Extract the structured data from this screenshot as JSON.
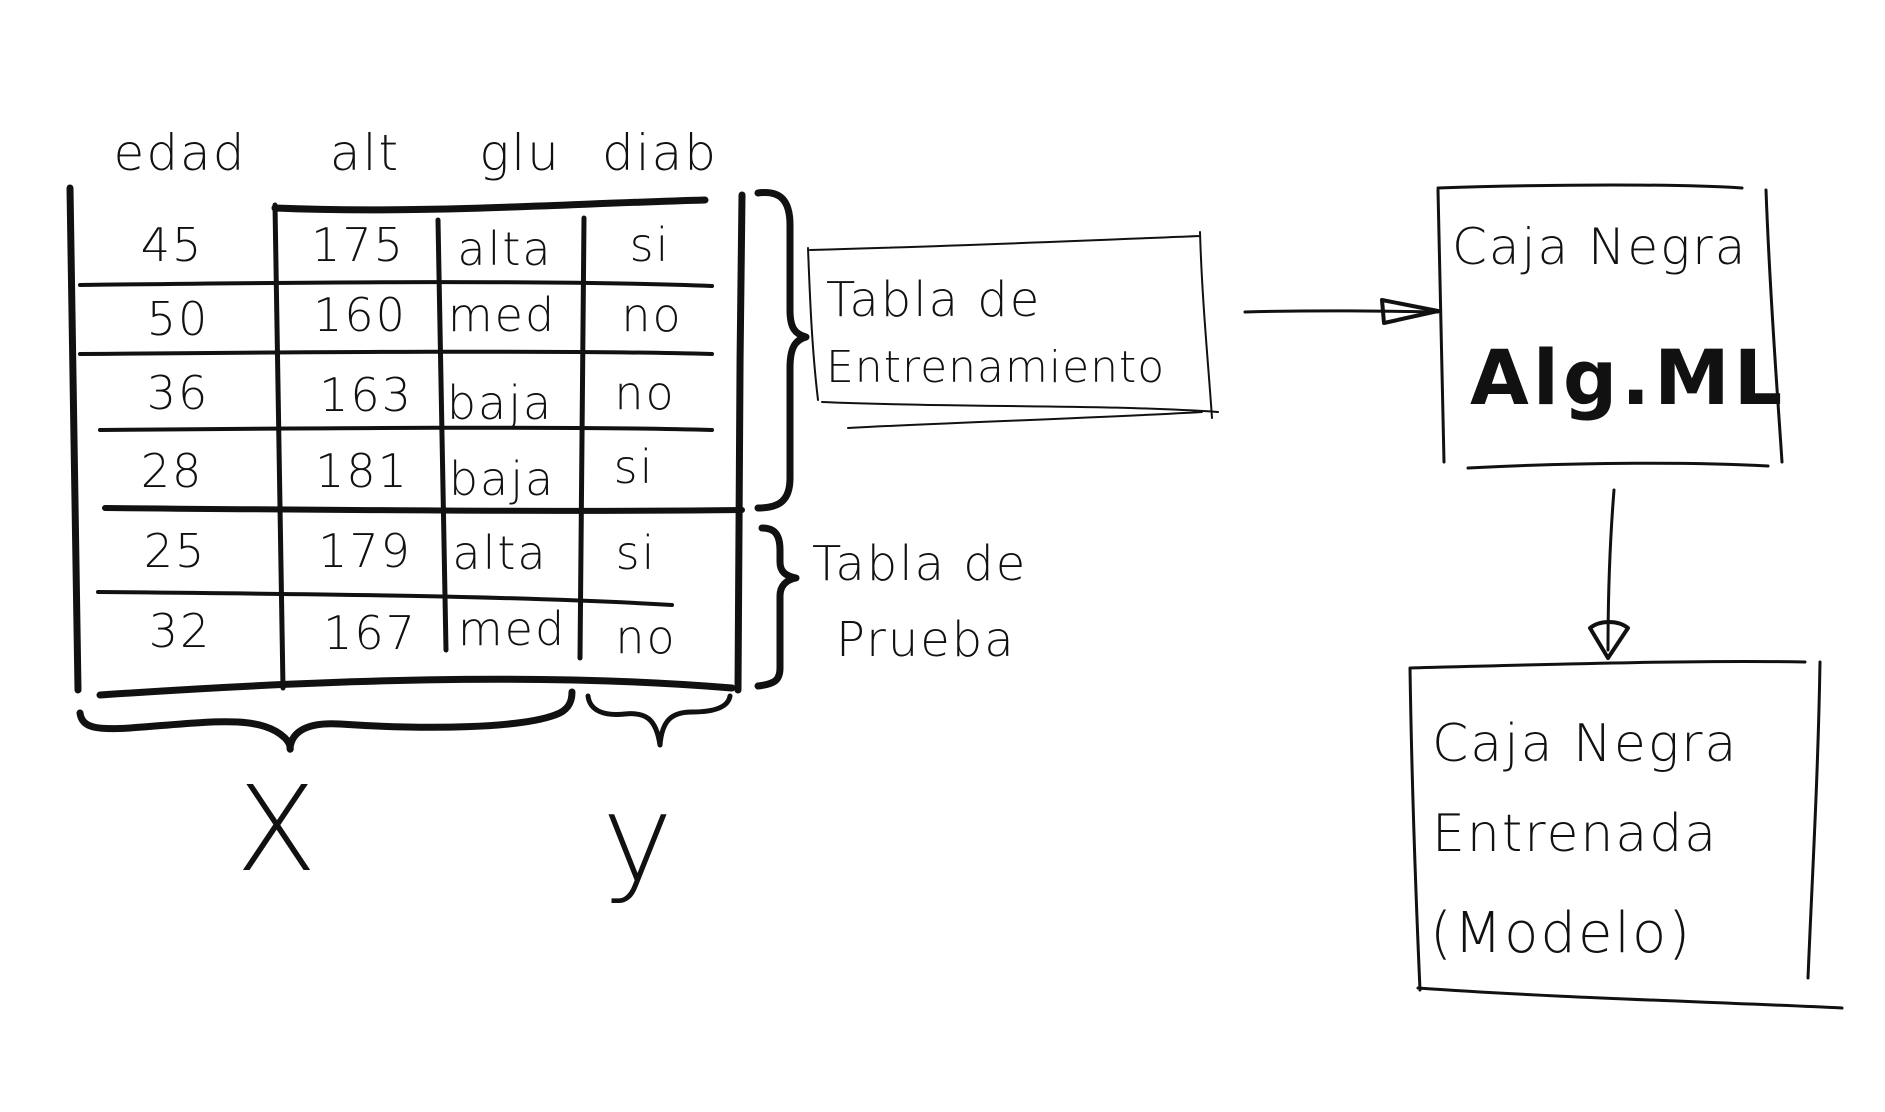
{
  "table": {
    "headers": [
      "edad",
      "alt",
      "glu",
      "diab"
    ],
    "rows": [
      [
        "45",
        "175",
        "alta",
        "si"
      ],
      [
        "50",
        "160",
        "med",
        "no"
      ],
      [
        "36",
        "163",
        "baja",
        "no"
      ],
      [
        "28",
        "181",
        "baja",
        "si"
      ],
      [
        "25",
        "179",
        "alta",
        "si"
      ],
      [
        "32",
        "167",
        "med",
        "no"
      ]
    ]
  },
  "brackets": {
    "x_label": "X",
    "y_label": "y"
  },
  "training_table": {
    "line1": "Tabla de",
    "line2": "Entrenamiento"
  },
  "test_table": {
    "line1": "Tabla de",
    "line2": "Prueba"
  },
  "black_box": {
    "line1": "Caja Negra",
    "line2": "Alg.ML"
  },
  "trained_box": {
    "line1": "Caja Negra",
    "line2": "Entrenada",
    "line3": "(Modelo)"
  }
}
